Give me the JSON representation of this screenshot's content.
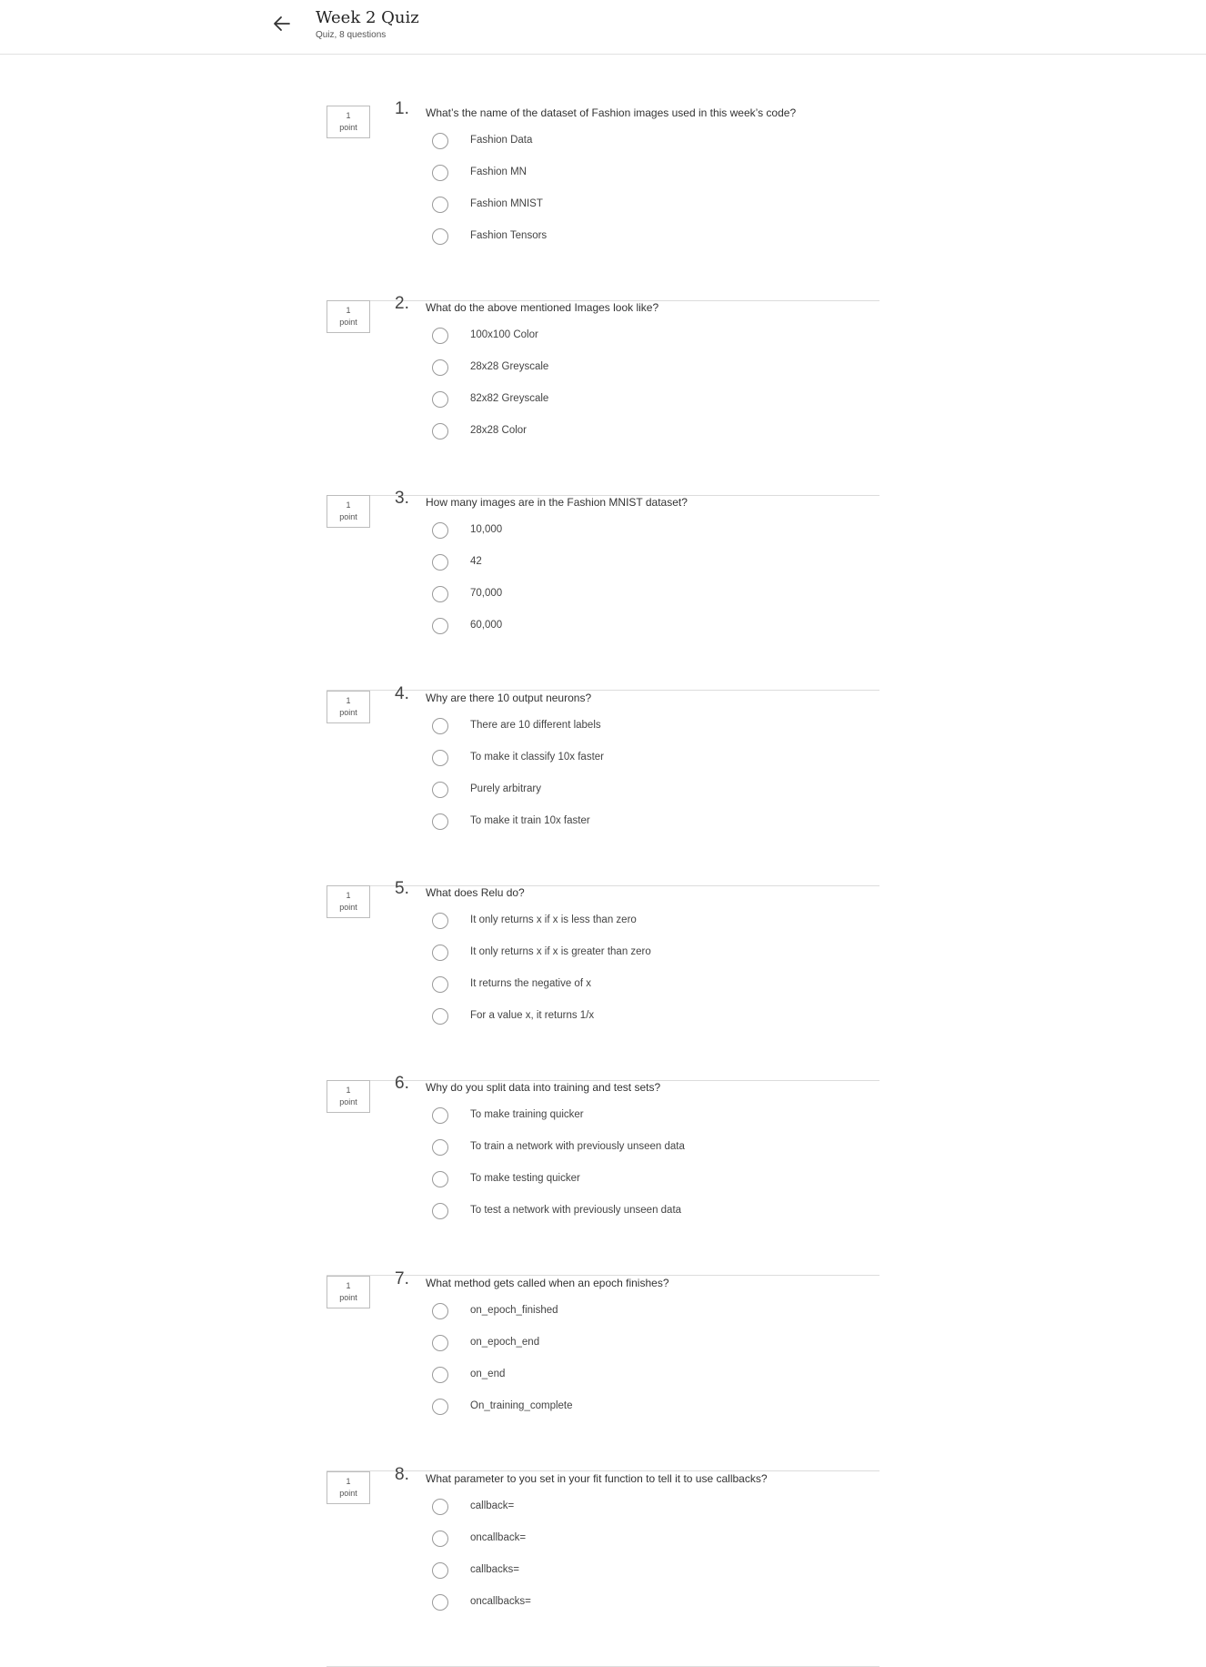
{
  "header": {
    "back_icon": "arrow-left-icon",
    "title": "Week 2 Quiz",
    "subtitle": "Quiz, 8 questions"
  },
  "questions": [
    {
      "number": "1.",
      "points_value": "1",
      "points_label": "point",
      "text": "What’s the name of the dataset of Fashion images used in this week’s code?",
      "options": [
        "Fashion Data",
        "Fashion MN",
        "Fashion MNIST",
        "Fashion Tensors"
      ]
    },
    {
      "number": "2.",
      "points_value": "1",
      "points_label": "point",
      "text": "What do the above mentioned Images look like?",
      "options": [
        "100x100 Color",
        "28x28 Greyscale",
        "82x82 Greyscale",
        "28x28 Color"
      ]
    },
    {
      "number": "3.",
      "points_value": "1",
      "points_label": "point",
      "text": "How many images are in the Fashion MNIST dataset?",
      "options": [
        "10,000",
        "42",
        "70,000",
        "60,000"
      ]
    },
    {
      "number": "4.",
      "points_value": "1",
      "points_label": "point",
      "text": "Why are there 10 output neurons?",
      "options": [
        "There are 10 different labels",
        "To make it classify 10x faster",
        "Purely arbitrary",
        "To make it train 10x faster"
      ]
    },
    {
      "number": "5.",
      "points_value": "1",
      "points_label": "point",
      "text": "What does Relu do?",
      "options": [
        "It only returns x if x is less than zero",
        "It only returns x if x is greater than zero",
        "It returns the negative of x",
        "For a value x, it returns 1/x"
      ]
    },
    {
      "number": "6.",
      "points_value": "1",
      "points_label": "point",
      "text": "Why do you split data into training and test sets?",
      "options": [
        "To make training quicker",
        "To train a network with previously unseen data",
        "To make testing quicker",
        "To test a network with previously unseen data"
      ]
    },
    {
      "number": "7.",
      "points_value": "1",
      "points_label": "point",
      "text": "What method gets called when an epoch finishes?",
      "options": [
        "on_epoch_finished",
        "on_epoch_end",
        "on_end",
        "On_training_complete"
      ]
    },
    {
      "number": "8.",
      "points_value": "1",
      "points_label": "point",
      "text": "What parameter to you set in your fit function to tell it to use callbacks?",
      "options": [
        "callback=",
        "oncallback=",
        "callbacks=",
        "oncallbacks="
      ]
    }
  ]
}
